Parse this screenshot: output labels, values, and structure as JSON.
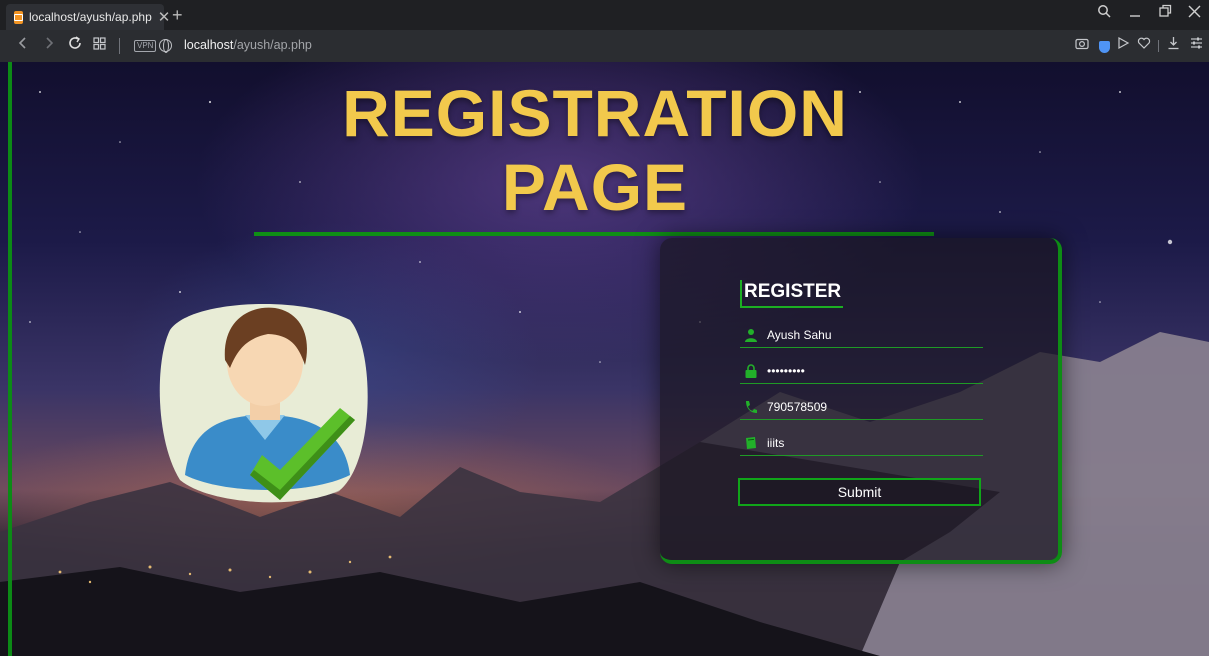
{
  "browser": {
    "tab_title": "localhost/ayush/ap.php",
    "tab_close": "✕",
    "new_tab": "+",
    "url_host": "localhost",
    "url_path": "/ayush/ap.php",
    "vpn_label": "VPN"
  },
  "page": {
    "heading_line1": "REGISTRATION",
    "heading_line2": "PAGE"
  },
  "form": {
    "title": "REGISTER",
    "name_value": "Ayush Sahu",
    "password_value": "123456789",
    "phone_value": "790578509",
    "college_value": "iiits",
    "submit_label": "Submit"
  },
  "colors": {
    "heading": "#f2c94c",
    "accent_green": "#0e8c15",
    "input_line": "#1f9a26"
  },
  "icons": [
    "user-icon",
    "lock-icon",
    "phone-icon",
    "book-icon",
    "check-icon"
  ]
}
